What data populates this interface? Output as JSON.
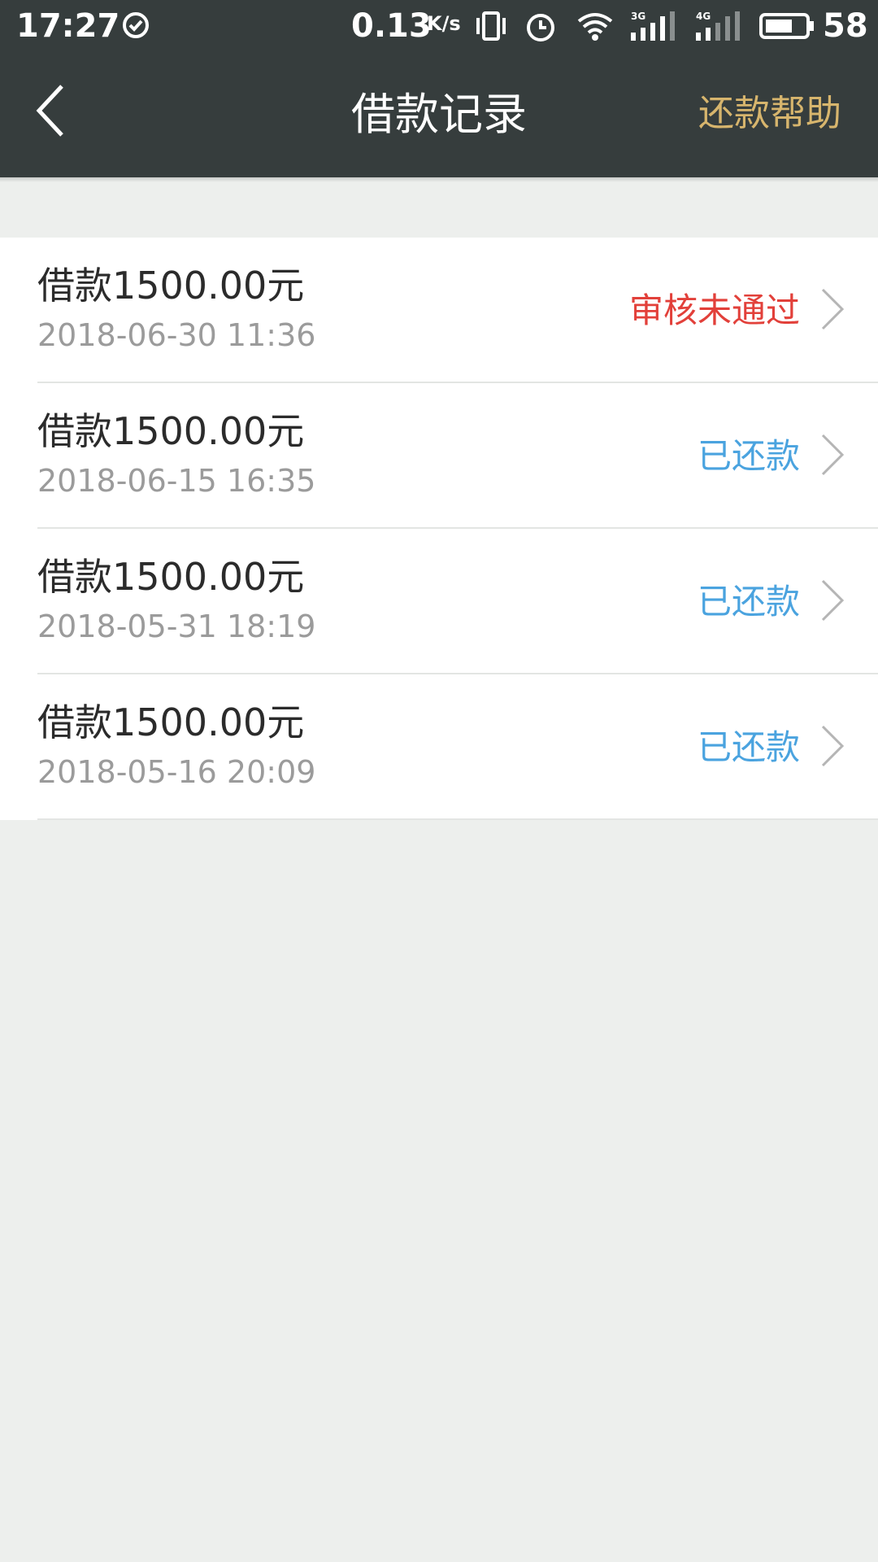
{
  "status_bar": {
    "time": "17:27",
    "net_speed": "0.13",
    "net_speed_unit": "K/s",
    "battery": "58",
    "icons": [
      "check-circle-icon",
      "vibrate-icon",
      "alarm-icon",
      "wifi-icon",
      "signal-3g-icon",
      "signal-4g-icon",
      "battery-icon"
    ],
    "signal_labels": {
      "first": "3G",
      "second": "4G"
    }
  },
  "header": {
    "title": "借款记录",
    "help_label": "还款帮助",
    "back_icon": "chevron-left-icon"
  },
  "colors": {
    "header_bg": "#363d3d",
    "help_link": "#d7b56d",
    "status_rejected": "#e2403a",
    "status_repaid": "#4aa3df",
    "page_bg": "#edefed"
  },
  "loans": [
    {
      "amount": "借款1500.00元",
      "date": "2018-06-30 11:36",
      "status": "审核未通过",
      "status_type": "rejected"
    },
    {
      "amount": "借款1500.00元",
      "date": "2018-06-15 16:35",
      "status": "已还款",
      "status_type": "repaid"
    },
    {
      "amount": "借款1500.00元",
      "date": "2018-05-31 18:19",
      "status": "已还款",
      "status_type": "repaid"
    },
    {
      "amount": "借款1500.00元",
      "date": "2018-05-16 20:09",
      "status": "已还款",
      "status_type": "repaid"
    }
  ]
}
